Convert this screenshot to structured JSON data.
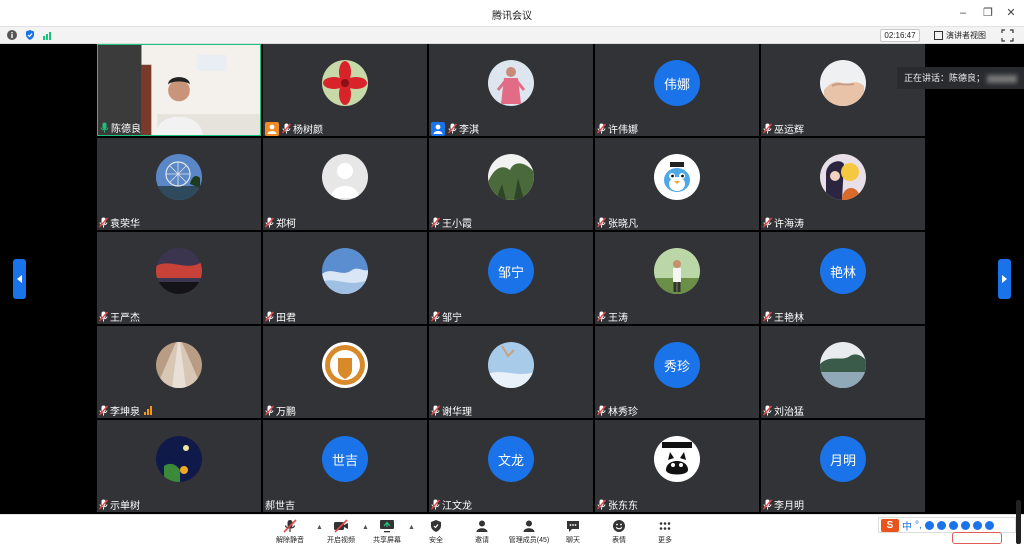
{
  "window": {
    "title": "腾讯会议"
  },
  "status": {
    "timer": "02:16:47",
    "speaker_view_label": "演讲者视图"
  },
  "speaking_now": {
    "label": "正在讲话：陈德良；"
  },
  "colors": {
    "accent": "#1a73e8",
    "tile_bg": "#323337",
    "active_border": "#19c37d",
    "mic_muted": "#e84646",
    "signal": "#f39a1e"
  },
  "participants": [
    {
      "name": "陈德良",
      "avatar": "video",
      "mic": "on"
    },
    {
      "name": "杨树颜",
      "avatar": "red-flower",
      "mic": "muted",
      "badge": "host-orange"
    },
    {
      "name": "李淇",
      "avatar": "figure-photo",
      "mic": "muted",
      "badge": "cohost-blue"
    },
    {
      "name": "许伟娜",
      "avatar_text": "伟娜",
      "mic": "muted"
    },
    {
      "name": "巫运辉",
      "avatar": "hands-photo",
      "mic": "muted"
    },
    {
      "name": "袁荣华",
      "avatar": "ferris-wheel",
      "mic": "muted"
    },
    {
      "name": "郑柯",
      "avatar": "default-silhouette",
      "mic": "muted"
    },
    {
      "name": "王小霞",
      "avatar": "tree-photo",
      "mic": "muted"
    },
    {
      "name": "张晓凡",
      "avatar": "cartoon-bird",
      "mic": "muted"
    },
    {
      "name": "许海涛",
      "avatar": "anime-photo",
      "mic": "muted"
    },
    {
      "name": "王严杰",
      "avatar": "red-sky",
      "mic": "muted"
    },
    {
      "name": "田君",
      "avatar": "sea-clouds",
      "mic": "muted"
    },
    {
      "name": "邹宁",
      "avatar_text": "邹宁",
      "mic": "muted"
    },
    {
      "name": "王涛",
      "avatar": "person-outdoor",
      "mic": "muted"
    },
    {
      "name": "王艳林",
      "avatar_text": "艳林",
      "mic": "muted"
    },
    {
      "name": "李坤泉",
      "avatar": "road-photo",
      "mic": "muted",
      "signal": true
    },
    {
      "name": "万鹏",
      "avatar": "school-emblem",
      "mic": "muted"
    },
    {
      "name": "谢华理",
      "avatar": "sky-photo",
      "mic": "muted"
    },
    {
      "name": "林秀珍",
      "avatar_text": "秀珍",
      "mic": "muted"
    },
    {
      "name": "刘治猛",
      "avatar": "lake-photo",
      "mic": "muted"
    },
    {
      "name": "示单树",
      "avatar": "night-photo",
      "mic": "muted"
    },
    {
      "name": "郝世吉",
      "avatar_text": "世吉",
      "mic": "none"
    },
    {
      "name": "江文龙",
      "avatar_text": "文龙",
      "mic": "muted"
    },
    {
      "name": "张东东",
      "avatar": "black-cat",
      "mic": "muted"
    },
    {
      "name": "李月明",
      "avatar_text": "月明",
      "mic": "muted"
    }
  ],
  "toolbar": {
    "unmute": "解除静音",
    "start_video": "开启视频",
    "share_screen": "共享屏幕",
    "security": "安全",
    "invite": "邀请",
    "manage_members": "管理成员(45)",
    "chat": "聊天",
    "reactions": "表情",
    "more": "更多"
  },
  "ime": {
    "chinese_label": "中"
  }
}
